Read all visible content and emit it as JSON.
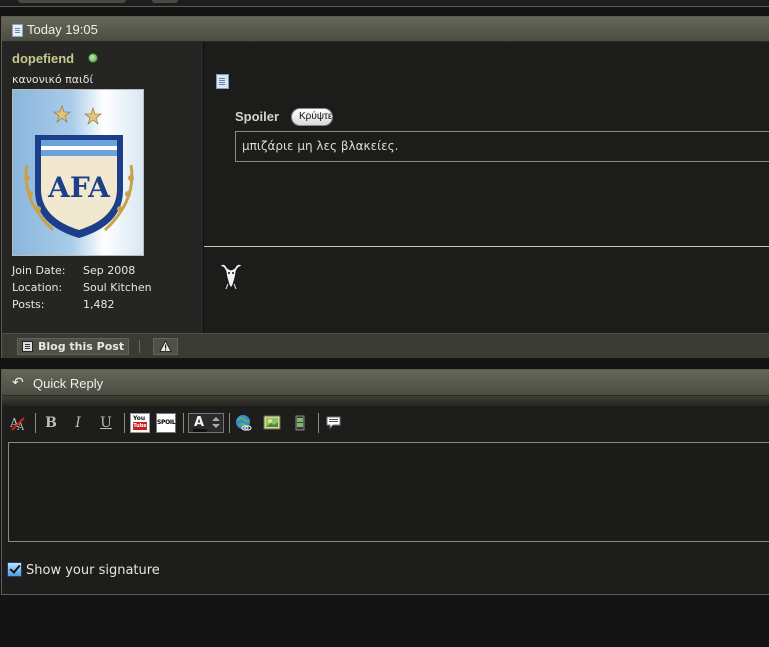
{
  "post": {
    "date": "Today 19:05",
    "user": {
      "username": "dopefiend",
      "title": "κανονικό παιδί",
      "info": [
        {
          "label": "Join Date:",
          "value": "Sep 2008"
        },
        {
          "label": "Location:",
          "value": "Soul Kitchen"
        },
        {
          "label": "Posts:",
          "value": "1,482"
        }
      ]
    },
    "spoiler": {
      "label": "Spoiler",
      "button": "Κρύψτε",
      "text": "μπιζάριε μη λες βλακείες."
    },
    "footer": {
      "blog_label": "Blog this Post"
    }
  },
  "quick_reply": {
    "title": "Quick Reply",
    "show_signature_label": "Show your signature",
    "show_signature_checked": true,
    "toolbar": {
      "bold": "B",
      "italic": "I",
      "underline": "U",
      "spoiler_tag": "SPOIL",
      "font_color_glyph": "A"
    }
  },
  "colors": {
    "header_bar": "#5a5c4f",
    "username": "#c8c98c",
    "page_bg": "#141414"
  }
}
